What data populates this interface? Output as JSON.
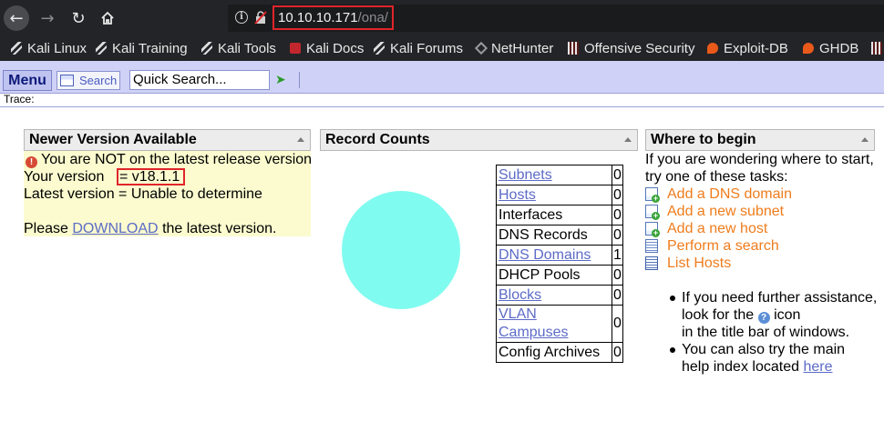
{
  "browser": {
    "url_host": "10.10.10.171",
    "url_path": "/ona/",
    "bookmarks": [
      {
        "label": "Kali Linux",
        "icon": "kali-dragon-icon"
      },
      {
        "label": "Kali Training",
        "icon": "kali-dragon-icon"
      },
      {
        "label": "Kali Tools",
        "icon": "kali-dragon-icon"
      },
      {
        "label": "Kali Docs",
        "icon": "kali-docs-icon"
      },
      {
        "label": "Kali Forums",
        "icon": "kali-dragon-icon"
      },
      {
        "label": "NetHunter",
        "icon": "nethunter-icon"
      },
      {
        "label": "Offensive Security",
        "icon": "offsec-icon"
      },
      {
        "label": "Exploit-DB",
        "icon": "exploit-db-icon"
      },
      {
        "label": "GHDB",
        "icon": "exploit-db-icon"
      }
    ]
  },
  "menubar": {
    "menu_label": "Menu",
    "search_label": "Search",
    "quick_search_value": "Quick Search...",
    "trace_label": "Trace:"
  },
  "version_panel": {
    "title": "Newer Version Available",
    "warning": "You are NOT on the latest release version",
    "your_version_label": "Your version",
    "your_version_value": "= v18.1.1",
    "latest_version": "Latest version = Unable to determine",
    "please": "Please",
    "download_link": "DOWNLOAD",
    "the_latest": "the latest version."
  },
  "record_counts": {
    "title": "Record Counts",
    "rows": [
      {
        "label": "Subnets",
        "count": "0",
        "link": true
      },
      {
        "label": "Hosts",
        "count": "0",
        "link": true
      },
      {
        "label": "Interfaces",
        "count": "0",
        "link": false
      },
      {
        "label": "DNS Records",
        "count": "0",
        "link": false
      },
      {
        "label": "DNS Domains",
        "count": "1",
        "link": true
      },
      {
        "label": "DHCP Pools",
        "count": "0",
        "link": false
      },
      {
        "label": "Blocks",
        "count": "0",
        "link": true
      },
      {
        "label": "VLAN Campuses",
        "count": "0",
        "link": true
      },
      {
        "label": "Config Archives",
        "count": "0",
        "link": false
      }
    ],
    "pie_color": "#80fbef"
  },
  "where_to_begin": {
    "title": "Where to begin",
    "intro_line1": "If you are wondering where to start,",
    "intro_line2": "try one of these tasks:",
    "tasks": [
      {
        "label": "Add a DNS domain",
        "icon": "add-dns-domain-icon"
      },
      {
        "label": "Add a new subnet",
        "icon": "add-subnet-icon"
      },
      {
        "label": "Add a new host",
        "icon": "add-host-icon"
      },
      {
        "label": "Perform a search",
        "icon": "search-doc-icon"
      },
      {
        "label": "List Hosts",
        "icon": "list-icon"
      }
    ],
    "help_line1": "If you need further assistance,",
    "help_line2a": "look for the",
    "help_line2b": "icon",
    "help_line3": "in the title bar of windows.",
    "help_line4": "You can also try the main",
    "help_line5": "help index located",
    "help_link": "here"
  },
  "colors": {
    "menubar": "#cfd2f6",
    "link": "#5c6bc7",
    "task_link": "#ef7c1c",
    "highlight_box": "#e0252a",
    "version_bg": "#fbfbcf"
  }
}
